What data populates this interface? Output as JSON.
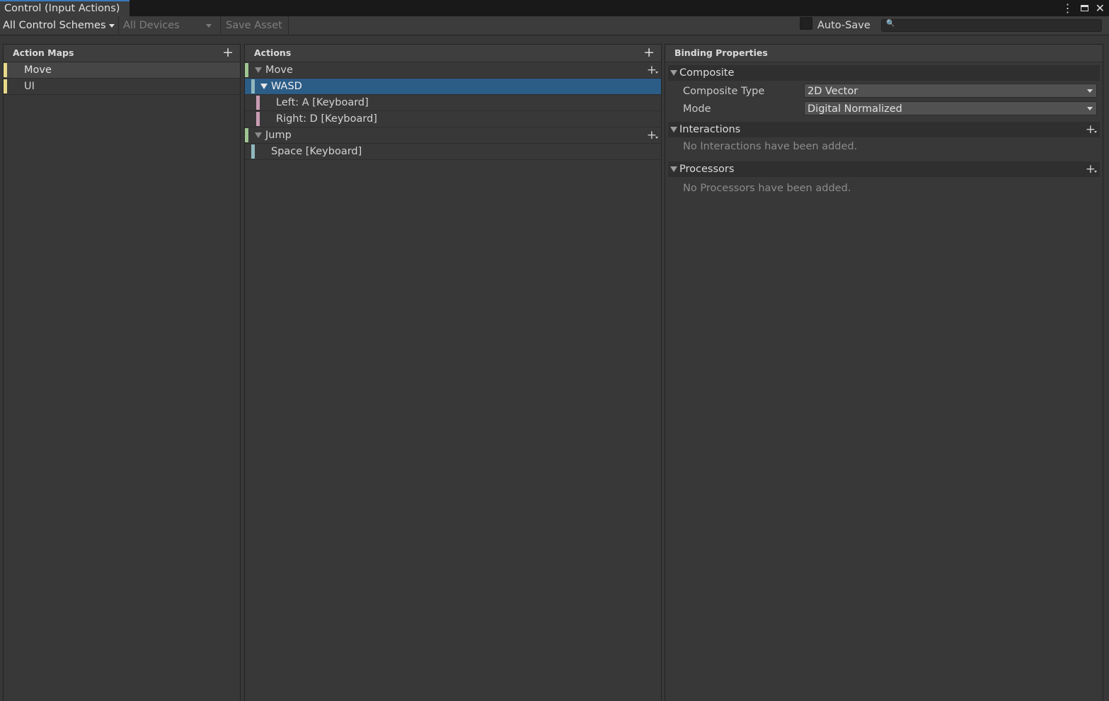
{
  "window": {
    "tab_title": "Control (Input Actions)"
  },
  "toolbar": {
    "control_scheme": "All Control Schemes",
    "devices": "All Devices",
    "save_asset": "Save Asset",
    "auto_save_label": "Auto-Save",
    "auto_save_checked": false,
    "search_value": ""
  },
  "action_maps": {
    "title": "Action Maps",
    "items": [
      {
        "label": "Move",
        "selected": true
      },
      {
        "label": "UI",
        "selected": false
      }
    ]
  },
  "actions": {
    "title": "Actions",
    "rows": [
      {
        "label": "Move"
      },
      {
        "label": "WASD"
      },
      {
        "label": "Left: A [Keyboard]"
      },
      {
        "label": "Right: D [Keyboard]"
      },
      {
        "label": "Jump"
      },
      {
        "label": "Space [Keyboard]"
      }
    ]
  },
  "binding_properties": {
    "title": "Binding Properties",
    "composite": {
      "header": "Composite",
      "composite_type_label": "Composite Type",
      "composite_type_value": "2D Vector",
      "mode_label": "Mode",
      "mode_value": "Digital Normalized"
    },
    "interactions": {
      "header": "Interactions",
      "empty_text": "No Interactions have been added."
    },
    "processors": {
      "header": "Processors",
      "empty_text": "No Processors have been added."
    }
  },
  "colors": {
    "action_map_marker": "#e8d98a",
    "action_marker": "#9fc592",
    "composite_marker": "#8fb8bd",
    "binding_marker": "#c99cb4",
    "selection": "#2c5d87"
  }
}
